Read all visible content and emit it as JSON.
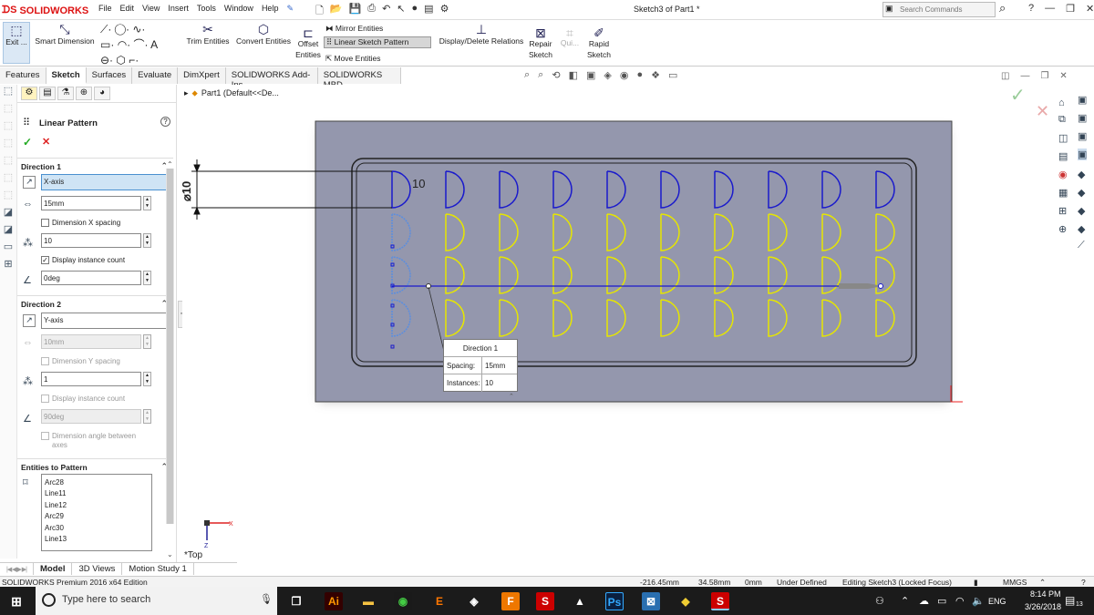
{
  "app": {
    "name": "SOLIDWORKS",
    "doc_title": "Sketch3 of Part1 *"
  },
  "menus": [
    "File",
    "Edit",
    "View",
    "Insert",
    "Tools",
    "Window",
    "Help"
  ],
  "search": {
    "placeholder": "Search Commands"
  },
  "ribbon": {
    "exit_label": "Exit ...",
    "smart_dimension": "Smart Dimension",
    "trim_entities": "Trim Entities",
    "convert_entities": "Convert Entities",
    "offset_entities_1": "Offset",
    "offset_entities_2": "Entities",
    "mirror_entities": "Mirror Entities",
    "linear_sketch_pattern": "Linear Sketch Pattern",
    "move_entities": "Move Entities",
    "display_delete_relations": "Display/Delete Relations",
    "repair_sketch_1": "Repair",
    "repair_sketch_2": "Sketch",
    "quick_snaps": "Qui...",
    "rapid_sketch_1": "Rapid",
    "rapid_sketch_2": "Sketch"
  },
  "tabs": [
    "Features",
    "Sketch",
    "Surfaces",
    "Evaluate",
    "DimXpert",
    "SOLIDWORKS Add-Ins",
    "SOLIDWORKS MBD"
  ],
  "tree": {
    "part_label": "Part1  (Default<<De..."
  },
  "pm": {
    "title": "Linear Pattern",
    "direction1": {
      "header": "Direction 1",
      "axis": "X-axis",
      "spacing": "15mm",
      "dim_spacing_label": "Dimension X spacing",
      "instances": "10",
      "display_count_label": "Display instance count",
      "angle": "0deg"
    },
    "direction2": {
      "header": "Direction 2",
      "axis": "Y-axis",
      "spacing": "10mm",
      "dim_spacing_label": "Dimension Y spacing",
      "instances": "1",
      "display_count_label": "Display instance count",
      "angle": "90deg",
      "dim_angle_label_1": "Dimension angle between",
      "dim_angle_label_2": "axes"
    },
    "entities": {
      "header": "Entities to Pattern",
      "items": [
        "Arc28",
        "Line11",
        "Line12",
        "Arc29",
        "Arc30",
        "Line13"
      ]
    }
  },
  "canvas": {
    "dim_diameter": "⌀10",
    "dim_count": "10",
    "view_label": "*Top",
    "popup": {
      "title": "Direction 1",
      "spacing_label": "Spacing:",
      "spacing_value": "15mm",
      "instances_label": "Instances:",
      "instances_value": "10"
    }
  },
  "bottom_tabs": [
    "Model",
    "3D Views",
    "Motion Study 1"
  ],
  "status": {
    "edition": "SOLIDWORKS Premium 2016 x64 Edition",
    "x": "-216.45mm",
    "y": "34.58mm",
    "z": "0mm",
    "state": "Under Defined",
    "editing": "Editing Sketch3 (Locked Focus)",
    "units": "MMGS"
  },
  "taskbar": {
    "search_placeholder": "Type here to search",
    "lang": "ENG",
    "time": "8:14 PM",
    "date": "3/26/2018",
    "notif_count": "13"
  },
  "colors": {
    "sketch_blue": "#1a1acc",
    "pattern_yellow": "#e6e600",
    "canvas_gray": "#9497ad",
    "accent_red": "#d11"
  }
}
